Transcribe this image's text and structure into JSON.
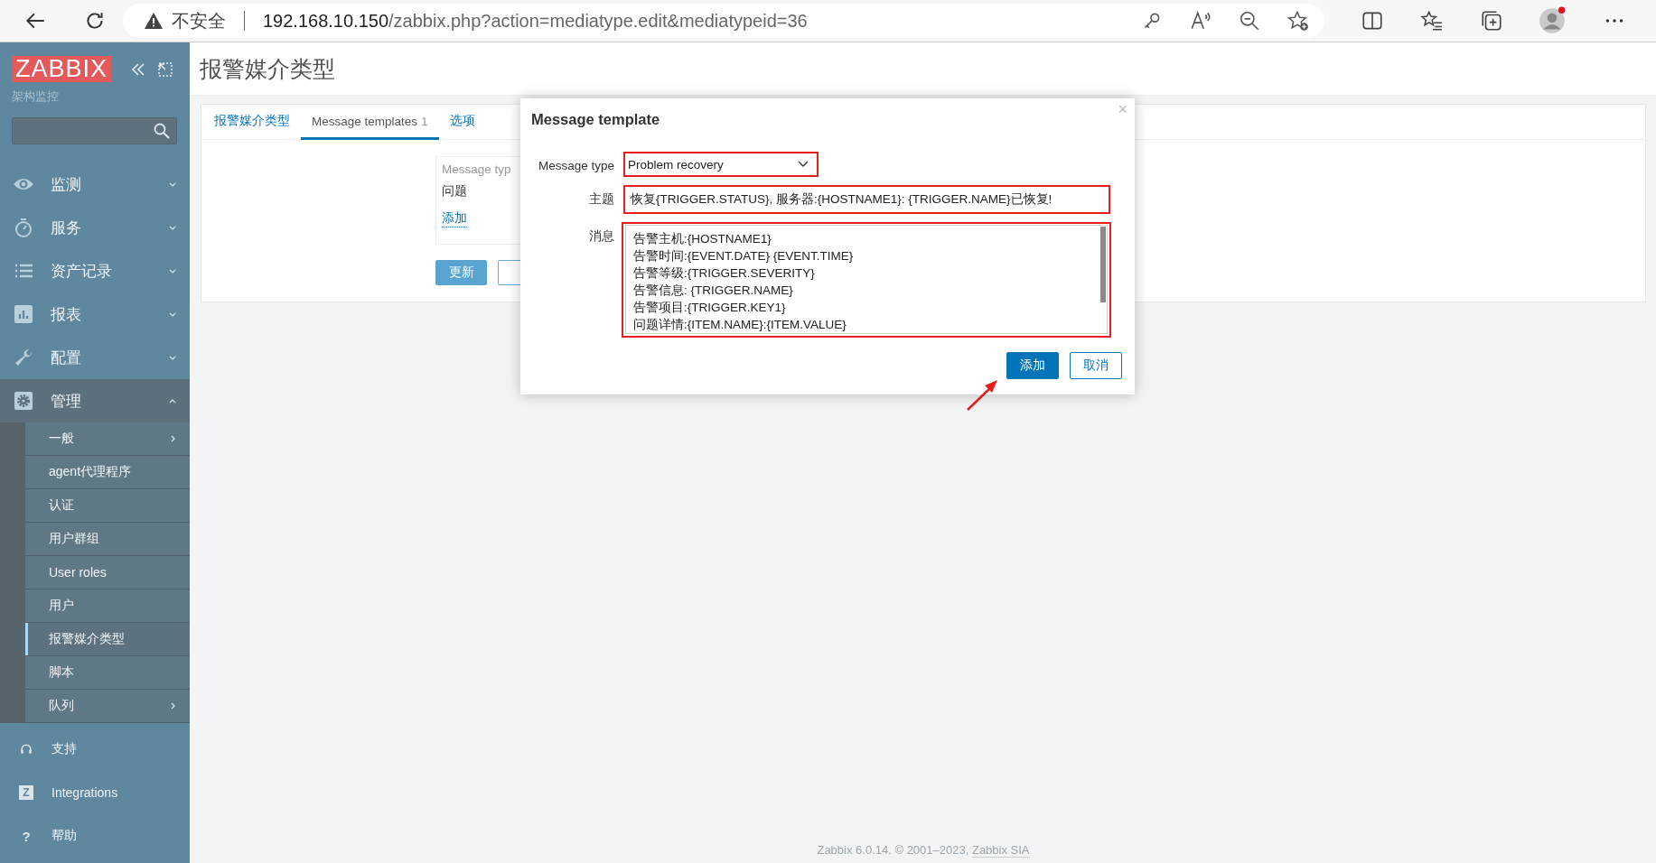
{
  "browser": {
    "security_label": "不安全",
    "url_host": "192.168.10.150",
    "url_path": "/zabbix.php?action=mediatype.edit&mediatypeid=36"
  },
  "sidebar": {
    "logo": "ZABBIX",
    "subtitle": "架构监控",
    "menu": [
      {
        "label": "监测",
        "kind": "eye",
        "expanded": false
      },
      {
        "label": "服务",
        "kind": "stopwatch",
        "expanded": false
      },
      {
        "label": "资产记录",
        "kind": "list",
        "expanded": false
      },
      {
        "label": "报表",
        "kind": "chart",
        "expanded": false
      },
      {
        "label": "配置",
        "kind": "wrench",
        "expanded": false
      },
      {
        "label": "管理",
        "kind": "gear",
        "expanded": true
      }
    ],
    "submenu": [
      {
        "label": "一般",
        "selected": false,
        "has_children": true
      },
      {
        "label": "agent代理程序",
        "selected": false,
        "has_children": false
      },
      {
        "label": "认证",
        "selected": false,
        "has_children": false
      },
      {
        "label": "用户群组",
        "selected": false,
        "has_children": false
      },
      {
        "label": "User roles",
        "selected": false,
        "has_children": false
      },
      {
        "label": "用户",
        "selected": false,
        "has_children": false
      },
      {
        "label": "报警媒介类型",
        "selected": true,
        "has_children": false
      },
      {
        "label": "脚本",
        "selected": false,
        "has_children": false
      },
      {
        "label": "队列",
        "selected": false,
        "has_children": true
      }
    ],
    "bottom_menu": [
      {
        "label": "支持",
        "kind": "headset"
      },
      {
        "label": "Integrations",
        "kind": "glyph",
        "glyph": "Z"
      },
      {
        "label": "帮助",
        "kind": "glyph",
        "glyph": "?"
      }
    ]
  },
  "page": {
    "title": "报警媒介类型",
    "tabs": [
      {
        "label": "报警媒介类型",
        "selected": false
      },
      {
        "label": "Message templates",
        "count": "1",
        "selected": true
      },
      {
        "label": "选项",
        "selected": false
      }
    ],
    "templates": {
      "header": "Message typ",
      "rows": [
        "问题"
      ],
      "add_link": "添加"
    },
    "update_button": "更新"
  },
  "dialog": {
    "title": "Message template",
    "close": "×",
    "fields": [
      {
        "label": "Message type",
        "kind": "select",
        "value": "Problem recovery"
      },
      {
        "label": "主题",
        "kind": "text",
        "value": "恢复{TRIGGER.STATUS}, 服务器:{HOSTNAME1}: {TRIGGER.NAME}已恢复!"
      },
      {
        "label": "消息",
        "kind": "textarea",
        "lines": [
          "告警主机:{HOSTNAME1}",
          "告警时间:{EVENT.DATE} {EVENT.TIME}",
          "告警等级:{TRIGGER.SEVERITY}",
          "告警信息: {TRIGGER.NAME}",
          "告警项目:{TRIGGER.KEY1}",
          "问题详情:{ITEM.NAME}:{ITEM.VALUE}"
        ]
      }
    ],
    "buttons": [
      {
        "label": "添加",
        "kind": "primary"
      },
      {
        "label": "取消",
        "kind": "secondary"
      }
    ]
  },
  "footer": {
    "text": "Zabbix 6.0.14. © 2001–2023, ",
    "link": "Zabbix SIA"
  }
}
